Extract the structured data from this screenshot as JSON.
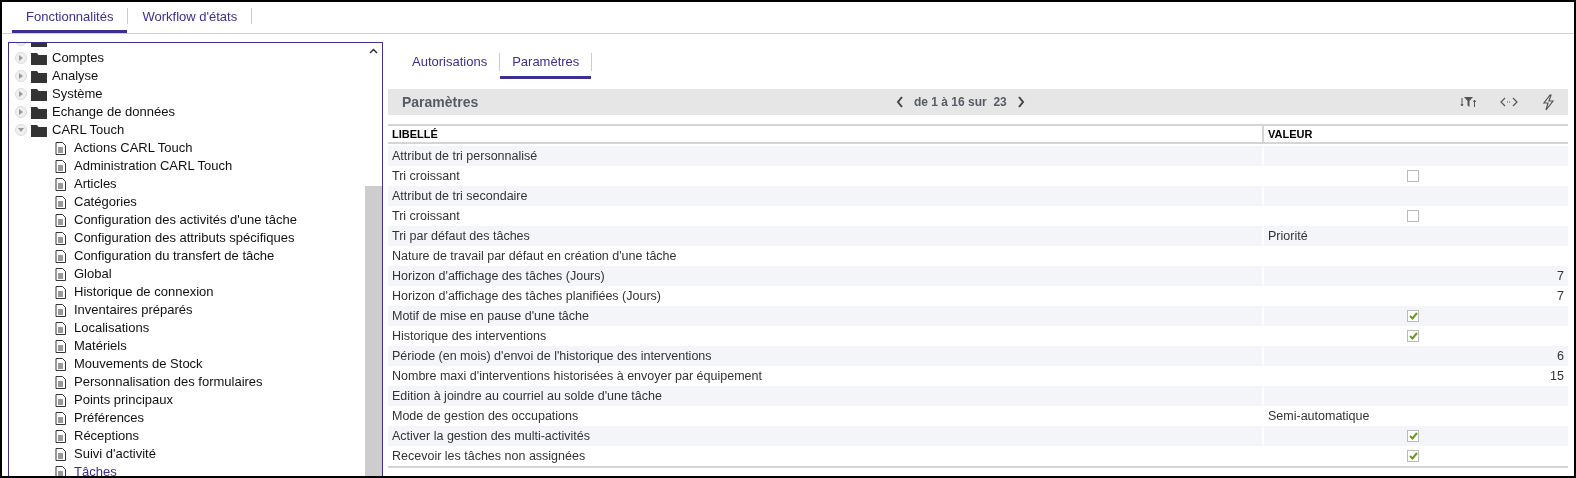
{
  "top_tabs": [
    {
      "label": "Fonctionnalités",
      "selected": true
    },
    {
      "label": "Workflow d'états",
      "selected": false
    }
  ],
  "tree": [
    {
      "label": "Comptes",
      "expanded": false
    },
    {
      "label": "Analyse",
      "expanded": false
    },
    {
      "label": "Système",
      "expanded": false
    },
    {
      "label": "Echange de données",
      "expanded": false
    },
    {
      "label": "CARL Touch",
      "expanded": true,
      "children": [
        {
          "label": "Actions CARL Touch",
          "selected": false
        },
        {
          "label": "Administration CARL Touch",
          "selected": false
        },
        {
          "label": "Articles",
          "selected": false
        },
        {
          "label": "Catégories",
          "selected": false
        },
        {
          "label": "Configuration des activités d'une tâche",
          "selected": false
        },
        {
          "label": "Configuration des attributs spécifiques",
          "selected": false
        },
        {
          "label": "Configuration du transfert de tâche",
          "selected": false
        },
        {
          "label": "Global",
          "selected": false
        },
        {
          "label": "Historique de connexion",
          "selected": false
        },
        {
          "label": "Inventaires préparés",
          "selected": false
        },
        {
          "label": "Localisations",
          "selected": false
        },
        {
          "label": "Matériels",
          "selected": false
        },
        {
          "label": "Mouvements de Stock",
          "selected": false
        },
        {
          "label": "Personnalisation des formulaires",
          "selected": false
        },
        {
          "label": "Points principaux",
          "selected": false
        },
        {
          "label": "Préférences",
          "selected": false
        },
        {
          "label": "Réceptions",
          "selected": false
        },
        {
          "label": "Suivi d'activité",
          "selected": false
        },
        {
          "label": "Tâches",
          "selected": true
        }
      ]
    }
  ],
  "tabs": [
    {
      "label": "Autorisations",
      "selected": false
    },
    {
      "label": "Paramètres",
      "selected": true
    }
  ],
  "panel": {
    "title": "Paramètres",
    "pager": "de 1 à 16 sur  23"
  },
  "table": {
    "columns": [
      "LIBELLÉ",
      "VALEUR"
    ],
    "rows": [
      {
        "label": "Attribut de tri personnalisé",
        "kind": "empty"
      },
      {
        "label": "Tri croissant",
        "kind": "checkbox",
        "checked": false
      },
      {
        "label": "Attribut de tri secondaire",
        "kind": "empty"
      },
      {
        "label": "Tri croissant",
        "kind": "checkbox",
        "checked": false
      },
      {
        "label": "Tri par défaut des tâches",
        "kind": "text",
        "value": "Priorité"
      },
      {
        "label": "Nature de travail par défaut en création d'une tâche",
        "kind": "empty"
      },
      {
        "label": "Horizon d'affichage des tâches (Jours)",
        "kind": "number",
        "value": "7"
      },
      {
        "label": "Horizon d'affichage des tâches planifiées (Jours)",
        "kind": "number",
        "value": "7"
      },
      {
        "label": "Motif de mise en pause d'une tâche",
        "kind": "checkbox",
        "checked": true
      },
      {
        "label": "Historique des interventions",
        "kind": "checkbox",
        "checked": true
      },
      {
        "label": "Période (en mois) d'envoi de l'historique des interventions",
        "kind": "number",
        "value": "6"
      },
      {
        "label": "Nombre maxi d'interventions historisées à envoyer par équipement",
        "kind": "number",
        "value": "15"
      },
      {
        "label": "Edition à joindre au courriel au solde d'une tâche",
        "kind": "empty"
      },
      {
        "label": "Mode de gestion des occupations",
        "kind": "text",
        "value": "Semi-automatique"
      },
      {
        "label": "Activer la gestion des multi-activités",
        "kind": "checkbox",
        "checked": true
      },
      {
        "label": "Recevoir les tâches non assignées",
        "kind": "checkbox",
        "checked": true
      }
    ]
  }
}
